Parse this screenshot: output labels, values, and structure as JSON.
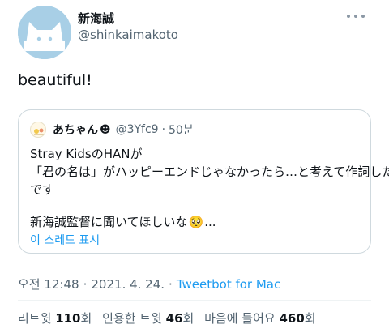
{
  "author": {
    "name": "新海誠",
    "handle": "@shinkaimakoto",
    "avatar_color": "#a8cfe6"
  },
  "tweet": {
    "text": "beautiful!"
  },
  "quote": {
    "name": "あちゃん",
    "name_emoji": "☻",
    "handle": "@3Yfc9",
    "separator": "·",
    "time": "50분",
    "lines": [
      "Stray KidsのHANが",
      "「君の名は」がハッピーエンドじゃなかったら…と考えて作詞した曲",
      "です",
      "新海誠監督に聞いてほしいな"
    ],
    "last_line_emoji": "🥺",
    "ellipsis": "...",
    "show_more": "이 스레드 표시"
  },
  "meta": {
    "time": "오전 12:48",
    "sep1": "·",
    "date": "2021. 4. 24.",
    "sep2": "·",
    "source": "Tweetbot for Mac"
  },
  "stats": {
    "retweets_label": "리트윗",
    "retweets_count": "110",
    "retweets_unit": "회",
    "quotes_label": "인용한 트윗",
    "quotes_count": "46",
    "quotes_unit": "회",
    "likes_label": "마음에 들어요",
    "likes_count": "460",
    "likes_unit": "회"
  },
  "colors": {
    "link": "#1d9bf0",
    "secondary_text": "#536471",
    "border": "#cfd9de"
  },
  "icons": {
    "more": "more-horizontal-icon",
    "avatar": "cat-avatar-icon",
    "quote_avatar": "quote-avatar-icon"
  }
}
